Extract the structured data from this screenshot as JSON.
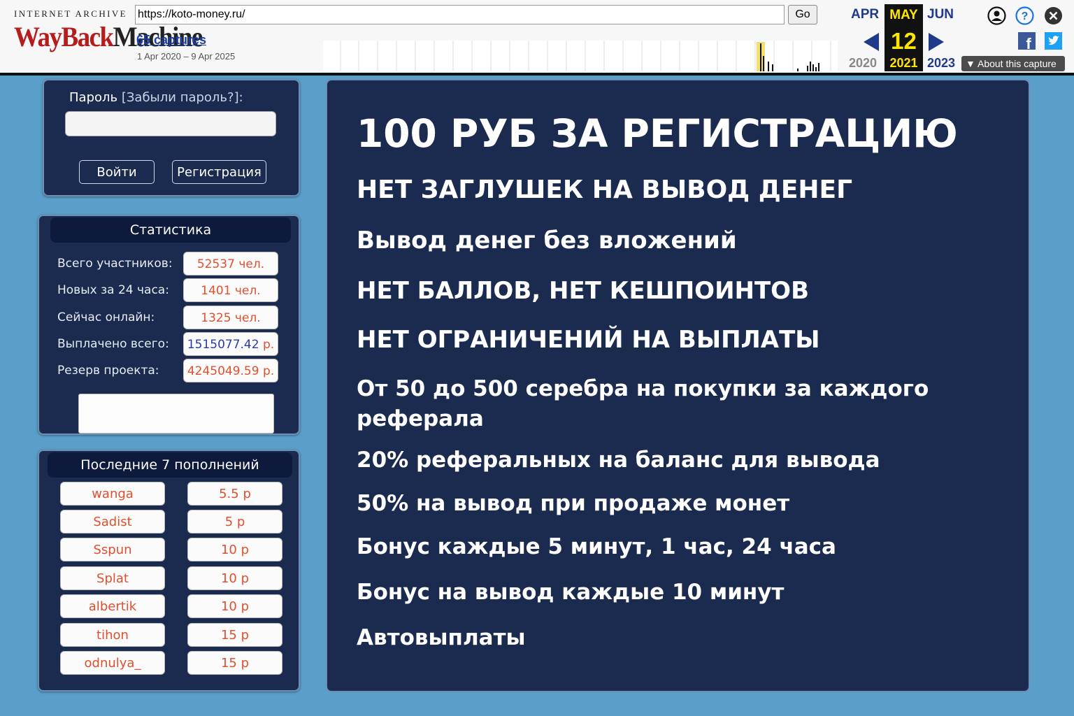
{
  "wayback": {
    "ia_text": "INTERNET ARCHIVE",
    "logo_part1": "WayBack",
    "logo_part2": "Machine",
    "url": "https://koto-money.ru/",
    "go_label": "Go",
    "captures": "65 captures",
    "date_range": "1 Apr 2020 – 9 Apr 2025",
    "prev_month": "APR",
    "cur_month": "MAY",
    "next_month": "JUN",
    "cur_day": "12",
    "prev_year": "2020",
    "cur_year": "2021",
    "next_year": "2023",
    "about": "About this capture"
  },
  "login": {
    "password_label": "Пароль",
    "forgot_label": "[Забыли пароль?]:",
    "login_button": "Войти",
    "register_button": "Регистрация"
  },
  "stats": {
    "title": "Статистика",
    "rows": [
      {
        "label": "Всего участников:",
        "value": "52537 чел.",
        "unit": ""
      },
      {
        "label": "Новых за 24 часа:",
        "value": "1401 чел.",
        "unit": ""
      },
      {
        "label": "Сейчас онлайн:",
        "value": "1325 чел.",
        "unit": ""
      },
      {
        "label": "Выплачено всего:",
        "value": "1515077.42",
        "unit": " р."
      },
      {
        "label": "Резерв проекта:",
        "value": "4245049.59 р.",
        "unit": ""
      }
    ]
  },
  "deposits": {
    "title": "Последние 7 пополнений",
    "rows": [
      {
        "name": "wanga",
        "amount": "5.5 р"
      },
      {
        "name": "Sadist",
        "amount": "5 р"
      },
      {
        "name": "Sspun",
        "amount": "10 р"
      },
      {
        "name": "Splat",
        "amount": "10 р"
      },
      {
        "name": "albertik",
        "amount": "10 р"
      },
      {
        "name": "tihon",
        "amount": "15 р"
      },
      {
        "name": "odnulya_",
        "amount": "15 р"
      }
    ]
  },
  "promo": {
    "headline": "100 РУБ ЗА РЕГИСТРАЦИЮ",
    "lines": [
      "НЕТ ЗАГЛУШЕК НА ВЫВОД ДЕНЕГ",
      "Вывод денег без вложений",
      "НЕТ БАЛЛОВ, НЕТ КЕШПОИНТОВ",
      "НЕТ ОГРАНИЧЕНИЙ НА ВЫПЛАТЫ",
      "От 50 до 500 серебра на покупки за каждого",
      "реферала",
      "20% реферальных на баланс для вывода",
      "50% на вывод при продаже монет",
      "Бонус каждые 5 минут, 1 час, 24 часа",
      "Бонус на вывод каждые 10 минут",
      "Автовыплаты"
    ]
  },
  "colors": {
    "page_bg": "#5a9fc9",
    "panel_bg": "#1a2b4f",
    "accent_orange": "#e0502e",
    "accent_blue": "#2b3aa8",
    "wayback_yellow": "#ffe600"
  }
}
